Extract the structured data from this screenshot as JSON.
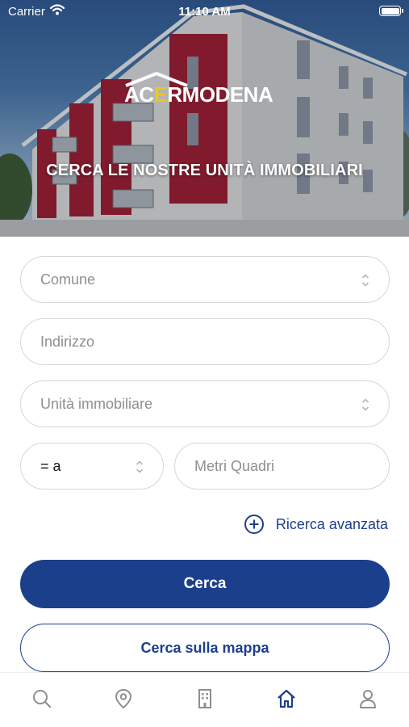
{
  "status_bar": {
    "carrier": "Carrier",
    "time": "11:10 AM"
  },
  "hero": {
    "logo_prefix": "AC",
    "logo_highlight": "E",
    "logo_suffix": "RMODENA",
    "title": "CERCA LE NOSTRE UNITÀ IMMOBILIARI"
  },
  "form": {
    "comune_placeholder": "Comune",
    "indirizzo_placeholder": "Indirizzo",
    "unita_placeholder": "Unità immobiliare",
    "operator_value": "= a",
    "metri_placeholder": "Metri Quadri"
  },
  "advanced_search_label": "Ricerca avanzata",
  "buttons": {
    "search": "Cerca",
    "search_map": "Cerca sulla mappa"
  },
  "tabs": [
    {
      "icon": "search-icon",
      "active": false
    },
    {
      "icon": "map-pin-icon",
      "active": false
    },
    {
      "icon": "building-icon",
      "active": false
    },
    {
      "icon": "home-icon",
      "active": true
    },
    {
      "icon": "user-icon",
      "active": false
    }
  ],
  "colors": {
    "primary": "#1c3f8b",
    "accent_logo": "#f2c418",
    "inactive_icon": "#8e8e94"
  }
}
